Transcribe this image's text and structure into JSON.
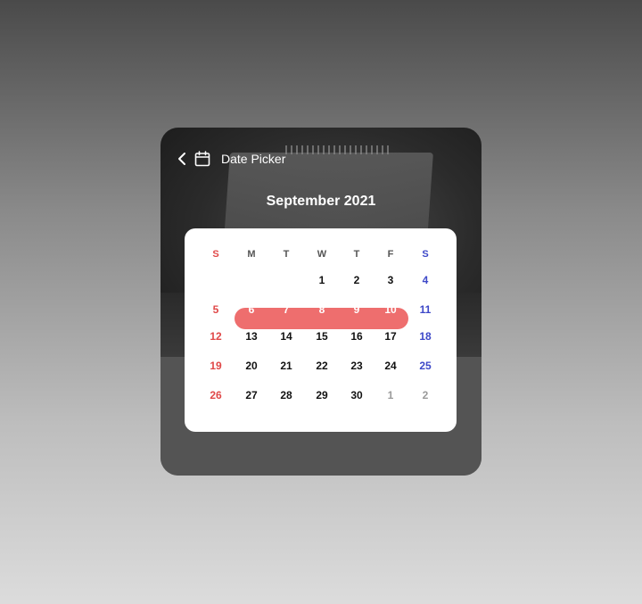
{
  "header": {
    "title": "Date Picker"
  },
  "calendar": {
    "month_label": "September 2021",
    "weekdays": [
      "S",
      "M",
      "T",
      "W",
      "T",
      "F",
      "S"
    ],
    "selected_range": [
      6,
      10
    ],
    "weeks": [
      [
        null,
        null,
        null,
        1,
        2,
        3,
        4
      ],
      [
        5,
        6,
        7,
        8,
        9,
        10,
        11
      ],
      [
        12,
        13,
        14,
        15,
        16,
        17,
        18
      ],
      [
        19,
        20,
        21,
        22,
        23,
        24,
        25
      ],
      [
        26,
        27,
        28,
        29,
        30,
        1,
        2
      ]
    ],
    "other_month_cells": [
      [
        4,
        5
      ],
      [
        4,
        6
      ]
    ]
  },
  "colors": {
    "range_fill": "#ee6e6e",
    "sunday": "#e04848",
    "saturday": "#3d48c8",
    "other_month": "#9a9a9a"
  },
  "icons": {
    "back": "chevron-left-icon",
    "calendar": "calendar-icon"
  }
}
